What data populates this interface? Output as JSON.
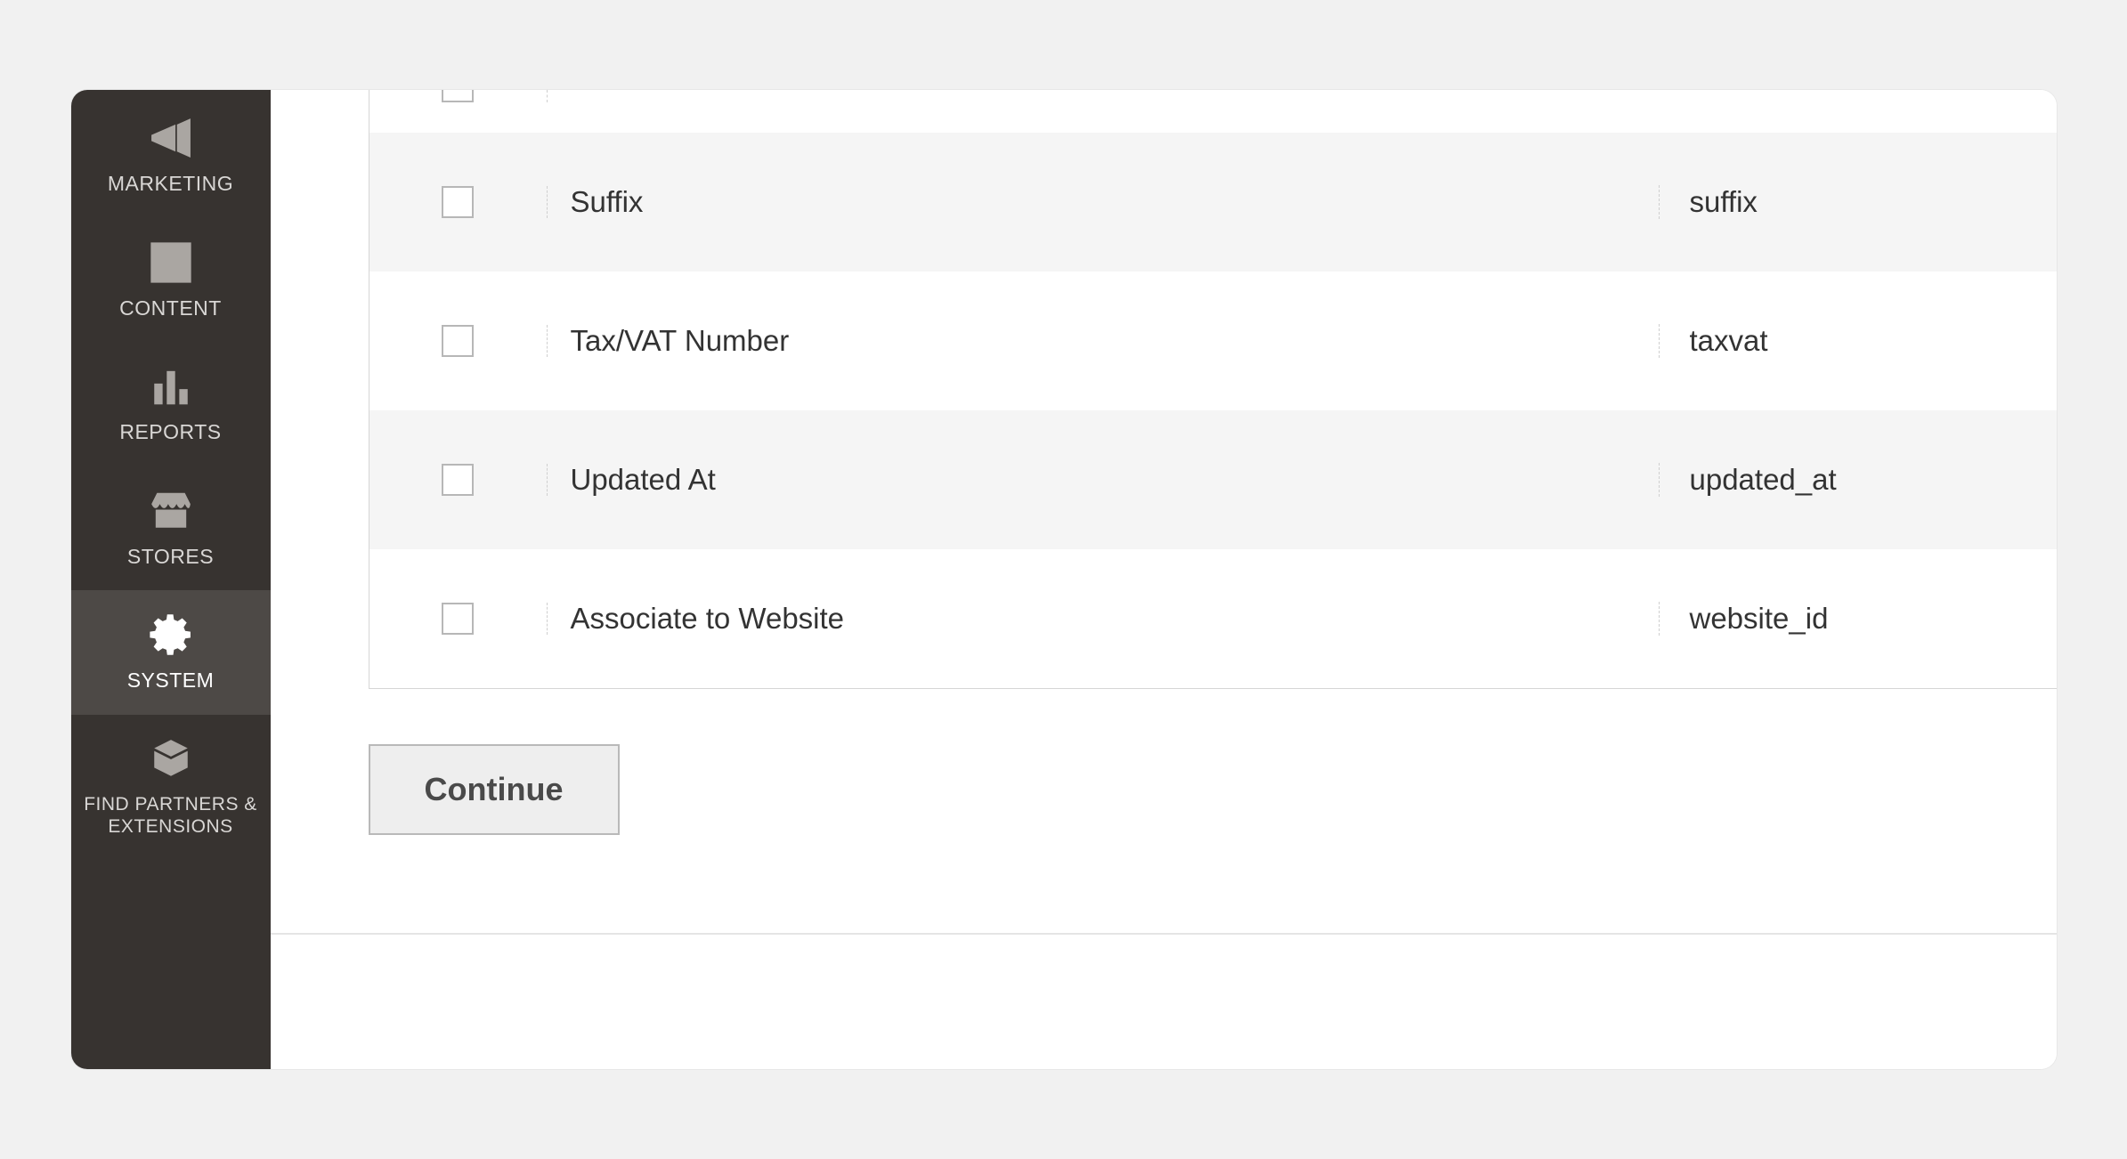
{
  "sidebar": {
    "items": [
      {
        "id": "marketing",
        "label": "MARKETING",
        "icon": "megaphone-icon",
        "active": false
      },
      {
        "id": "content",
        "label": "CONTENT",
        "icon": "layout-icon",
        "active": false
      },
      {
        "id": "reports",
        "label": "REPORTS",
        "icon": "bars-icon",
        "active": false
      },
      {
        "id": "stores",
        "label": "STORES",
        "icon": "storefront-icon",
        "active": false
      },
      {
        "id": "system",
        "label": "SYSTEM",
        "icon": "gear-icon",
        "active": true
      },
      {
        "id": "partners",
        "label": "FIND PARTNERS & EXTENSIONS",
        "icon": "blocks-icon",
        "active": false
      }
    ]
  },
  "table": {
    "rows": [
      {
        "label": "",
        "code": "",
        "partial": true,
        "alt": false
      },
      {
        "label": "Suffix",
        "code": "suffix",
        "partial": false,
        "alt": true
      },
      {
        "label": "Tax/VAT Number",
        "code": "taxvat",
        "partial": false,
        "alt": false
      },
      {
        "label": "Updated At",
        "code": "updated_at",
        "partial": false,
        "alt": true
      },
      {
        "label": "Associate to Website",
        "code": "website_id",
        "partial": false,
        "alt": false
      }
    ]
  },
  "actions": {
    "continue_label": "Continue"
  }
}
